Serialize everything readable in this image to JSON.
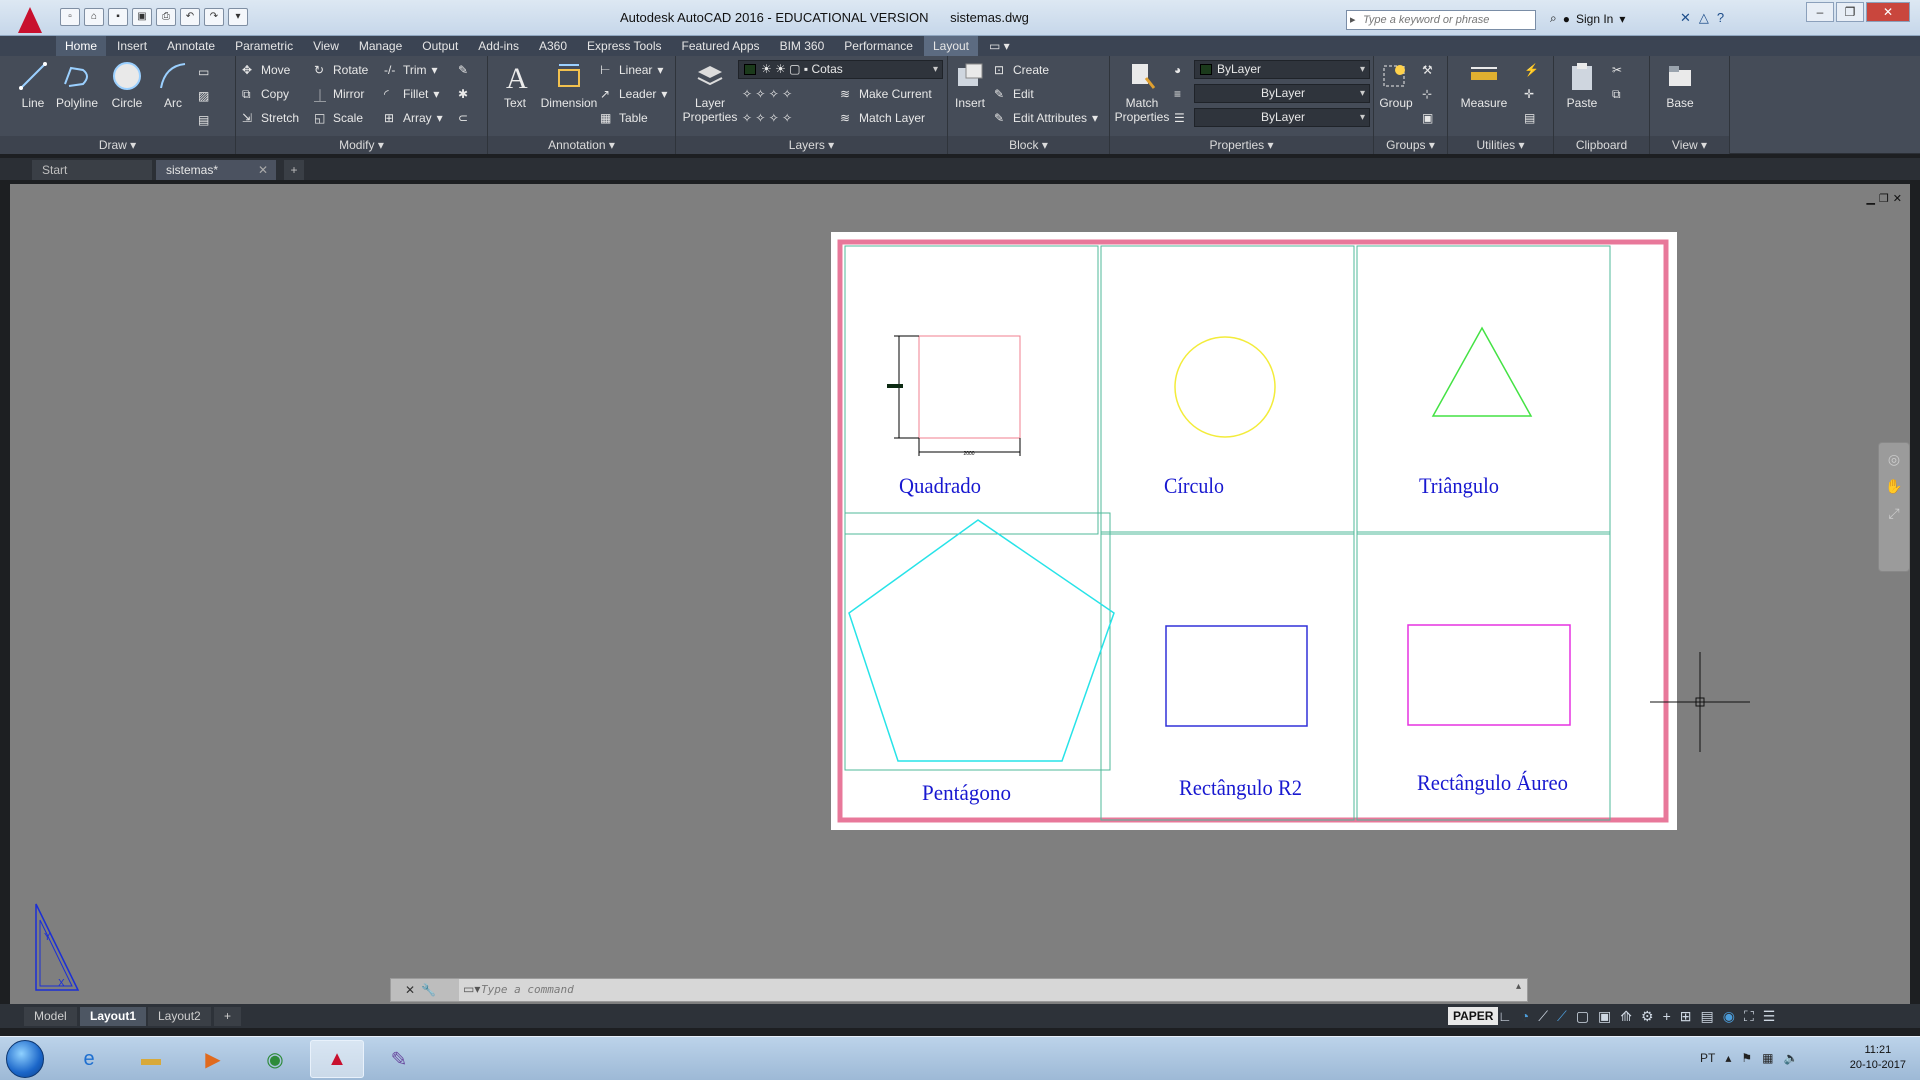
{
  "title_bar": {
    "app_title": "Autodesk AutoCAD 2016 - EDUCATIONAL VERSION",
    "doc_name": "sistemas.dwg",
    "search_placeholder": "Type a keyword or phrase",
    "sign_in": "Sign In"
  },
  "ribbon_tabs": [
    "Home",
    "Insert",
    "Annotate",
    "Parametric",
    "View",
    "Manage",
    "Output",
    "Add-ins",
    "A360",
    "Express Tools",
    "Featured Apps",
    "BIM 360",
    "Performance",
    "Layout"
  ],
  "ribbon": {
    "draw": {
      "title": "Draw",
      "line": "Line",
      "polyline": "Polyline",
      "circle": "Circle",
      "arc": "Arc"
    },
    "modify": {
      "title": "Modify",
      "move": "Move",
      "rotate": "Rotate",
      "trim": "Trim",
      "copy": "Copy",
      "mirror": "Mirror",
      "fillet": "Fillet",
      "stretch": "Stretch",
      "scale": "Scale",
      "array": "Array"
    },
    "annotation": {
      "title": "Annotation",
      "text": "Text",
      "dimension": "Dimension",
      "linear": "Linear",
      "leader": "Leader",
      "table": "Table"
    },
    "layers": {
      "title": "Layers",
      "layer_properties": "Layer Properties",
      "current_layer": "Cotas",
      "make_current": "Make Current",
      "match_layer": "Match Layer"
    },
    "block": {
      "title": "Block",
      "insert": "Insert",
      "create": "Create",
      "edit": "Edit",
      "edit_attributes": "Edit Attributes"
    },
    "properties": {
      "title": "Properties",
      "match_properties": "Match Properties",
      "color": "ByLayer",
      "linetype": "ByLayer",
      "lineweight": "ByLayer"
    },
    "groups": {
      "title": "Groups",
      "group": "Group"
    },
    "utilities": {
      "title": "Utilities",
      "measure": "Measure"
    },
    "clipboard": {
      "title": "Clipboard",
      "paste": "Paste"
    },
    "view": {
      "title": "View",
      "base": "Base"
    }
  },
  "file_tabs": {
    "start": "Start",
    "document": "sistemas*",
    "add": "+"
  },
  "drawing": {
    "labels": [
      "Quadrado",
      "Círculo",
      "Triângulo",
      "Pentágono",
      "Rectângulo R2",
      "Rectângulo Áureo"
    ],
    "dimension_text": "2000",
    "colors": {
      "frame": "#e8789a",
      "cell": "#4fb89a",
      "square": "#f07f8f",
      "circle": "#f3ec3a",
      "triangle": "#44e244",
      "pentagon": "#27e3e8",
      "rect_r2": "#3030d8",
      "rect_golden": "#e632e0",
      "label": "#1818d0"
    }
  },
  "command_line": {
    "placeholder": "Type  a  command"
  },
  "status_bar": {
    "tabs": [
      "Model",
      "Layout1",
      "Layout2"
    ],
    "add": "+",
    "space": "PAPER"
  },
  "taskbar": {
    "lang": "PT",
    "time": "11:21",
    "date": "20-10-2017"
  }
}
